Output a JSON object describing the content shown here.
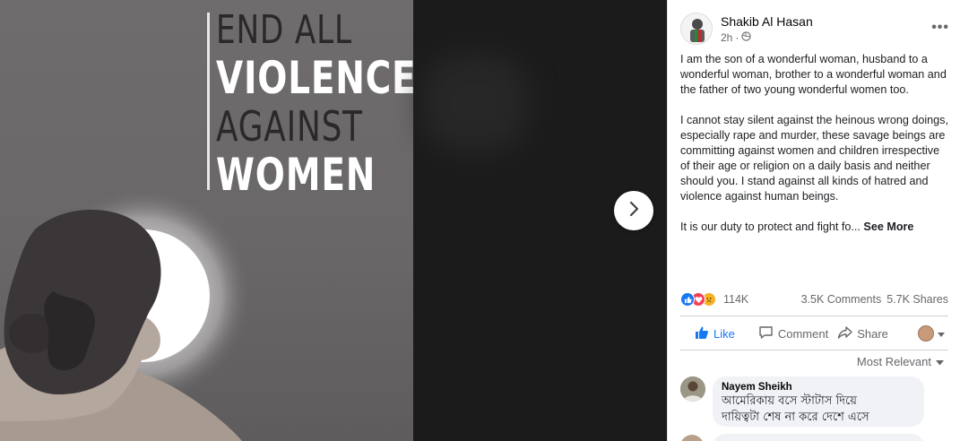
{
  "poster": {
    "line1": "END ALL",
    "line2": "VIOLENCE",
    "line3": "AGAINST",
    "line4": "WOMEN"
  },
  "post": {
    "author": "Shakib Al Hasan",
    "time": "2h",
    "time_sep": "·",
    "paragraphs": [
      "I am the son of a wonderful woman, husband to a wonderful woman, brother to a wonderful woman and the father of two young wonderful women too.",
      "I cannot stay silent against the heinous wrong doings, especially rape and murder, these savage beings are committing against women and children irrespective of their age or religion on a daily basis and neither should you. I stand against all kinds of hatred and violence against human beings.",
      "It is our duty to protect and fight fo..."
    ],
    "see_more": "See More"
  },
  "stats": {
    "reactions": "114K",
    "comments": "3.5K Comments",
    "shares": "5.7K Shares"
  },
  "actions": {
    "like": "Like",
    "comment": "Comment",
    "share": "Share"
  },
  "sort_label": "Most Relevant",
  "comments": [
    {
      "name": "Nayem Sheikh",
      "text_line1": "আমেরিকায় বসে স্টাটাস দিয়ে",
      "text_line2": "দায়িত্বটা শেষ না করে দেশে এসে"
    }
  ],
  "colors": {
    "accent": "#1877f2",
    "poster_bg": "#6a6768"
  }
}
